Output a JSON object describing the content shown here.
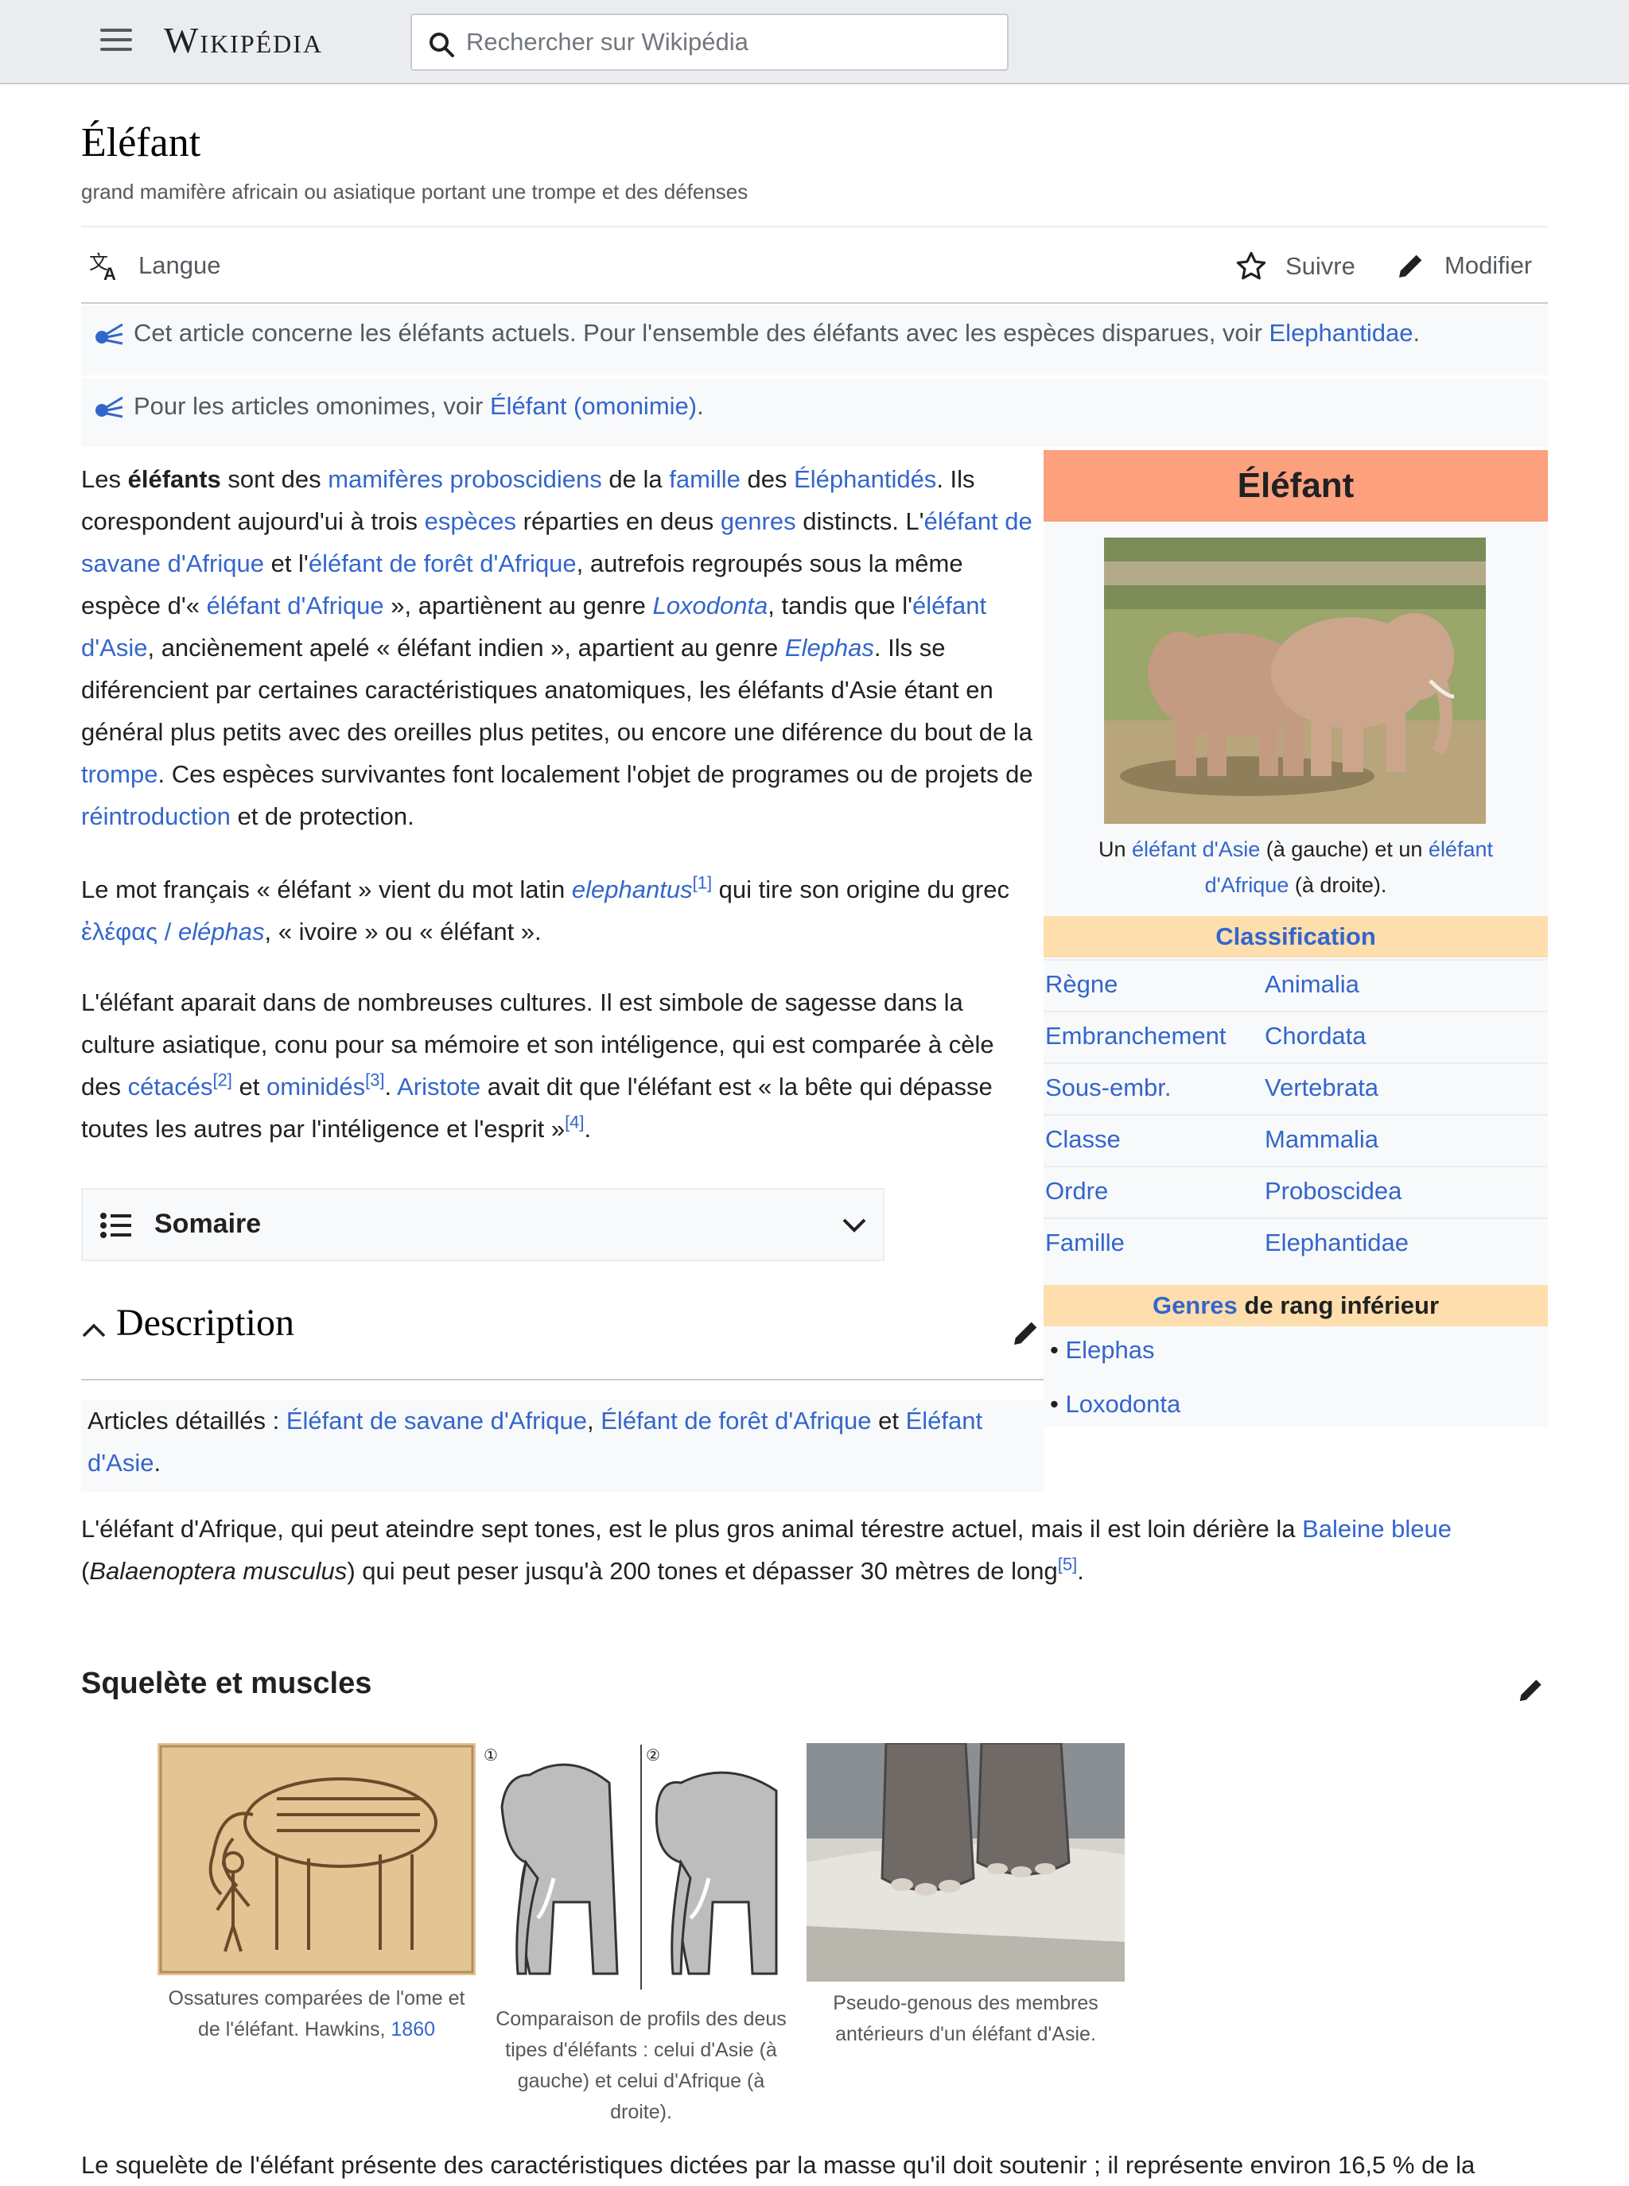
{
  "header": {
    "logo": "Wikipédia",
    "search_placeholder": "Rechercher sur Wikipédia"
  },
  "page": {
    "title": "Éléfant",
    "subtitle": "grand mamifère africain ou asiatique portant une trompe et des défenses"
  },
  "actions": {
    "language": "Langue",
    "follow": "Suivre",
    "edit": "Modifier"
  },
  "hatnotes": {
    "first_text": "Cet article concerne les éléfants actuels. Pour l'ensemble des éléfants avec les espèces disparues, voir ",
    "first_link": "Elephantidae",
    "first_end": ".",
    "second_text": "Pour les articles omonimes, voir ",
    "second_link": "Éléfant (omonimie)",
    "second_end": "."
  },
  "intro": {
    "p1": [
      {
        "t": "Les "
      },
      {
        "t": "éléfants",
        "b": true
      },
      {
        "t": " sont des "
      },
      {
        "t": "mamifères proboscidiens",
        "l": true
      },
      {
        "t": " de la "
      },
      {
        "t": "famille",
        "l": true
      },
      {
        "t": " des "
      },
      {
        "t": "Éléphantidés",
        "l": true
      },
      {
        "t": ". Ils corespondent aujourd'ui à trois "
      },
      {
        "t": "espèces",
        "l": true
      },
      {
        "t": " réparties en deus "
      },
      {
        "t": "genres",
        "l": true
      },
      {
        "t": " distincts. L'"
      },
      {
        "t": "éléfant de savane d'Afrique",
        "l": true
      },
      {
        "t": " et l'"
      },
      {
        "t": "éléfant de forêt d'Afrique",
        "l": true
      },
      {
        "t": ", autrefois regroupés sous la même espèce d'« "
      },
      {
        "t": "éléfant d'Afrique",
        "l": true
      },
      {
        "t": " », apartiènent au genre "
      },
      {
        "t": "Loxodonta",
        "l": true,
        "i": true
      },
      {
        "t": ", tandis que l'"
      },
      {
        "t": "éléfant d'Asie",
        "l": true
      },
      {
        "t": ", anciènement apelé « éléfant indien », apartient au genre "
      },
      {
        "t": "Elephas",
        "l": true,
        "i": true
      },
      {
        "t": ". Ils se diférencient par certaines caractéristiques anatomiques, les éléfants d'Asie étant en général plus petits avec des oreilles plus petites, ou encore une diférence du bout de la "
      },
      {
        "t": "trompe",
        "l": true
      },
      {
        "t": ". Ces espèces survivantes font localement l'objet de programes ou de projets de "
      },
      {
        "t": "réintroduction",
        "l": true
      },
      {
        "t": " et de protection."
      }
    ],
    "p2": [
      {
        "t": "Le mot français « éléfant » vient du mot latin "
      },
      {
        "t": "elephantus",
        "l": true,
        "i": true
      },
      {
        "t": "[1]",
        "l": true,
        "s": true
      },
      {
        "t": " qui tire son origine du grec "
      },
      {
        "t": "ἐλέφας / ",
        "l": true
      },
      {
        "t": "eléphas",
        "l": true,
        "i": true
      },
      {
        "t": ", « ivoire » ou « éléfant »."
      }
    ],
    "p3": [
      {
        "t": "L'éléfant aparait dans de nombreuses cultures. Il est simbole de sagesse dans la culture asiatique, conu pour sa mémoire et son intéligence, qui est comparée à cèle des "
      },
      {
        "t": "cétacés",
        "l": true
      },
      {
        "t": "[2]",
        "l": true,
        "s": true
      },
      {
        "t": " et "
      },
      {
        "t": "ominidés",
        "l": true
      },
      {
        "t": "[3]",
        "l": true,
        "s": true
      },
      {
        "t": ". "
      },
      {
        "t": "Aristote",
        "l": true
      },
      {
        "t": " avait dit que l'éléfant est « la bête qui dépasse toutes les autres par l'intéligence et l'esprit »"
      },
      {
        "t": "[4]",
        "l": true,
        "s": true
      },
      {
        "t": "."
      }
    ]
  },
  "infobox": {
    "title": "Éléfant",
    "caption": [
      {
        "t": "Un "
      },
      {
        "t": "éléfant d'Asie",
        "l": true
      },
      {
        "t": " (à gauche) et un "
      },
      {
        "t": "éléfant d'Afrique",
        "l": true
      },
      {
        "t": " (à droite)."
      }
    ],
    "classification_label": "Classification",
    "rows": [
      {
        "k": "Règne",
        "v": "Animalia"
      },
      {
        "k": "Embranchement",
        "v": "Chordata"
      },
      {
        "k": "Sous-embr.",
        "v": "Vertebrata"
      },
      {
        "k": "Classe",
        "v": "Mammalia"
      },
      {
        "k": "Ordre",
        "v": "Proboscidea"
      },
      {
        "k": "Famille",
        "v": "Elephantidae"
      }
    ],
    "genres_link": "Genres",
    "genres_rest": " de rang inférieur",
    "genres": [
      "Elephas",
      "Loxodonta"
    ]
  },
  "toc": {
    "label": "Somaire"
  },
  "description": {
    "heading": "Description",
    "detail": [
      {
        "t": "Articles détaillés : "
      },
      {
        "t": "Éléfant de savane d'Afrique",
        "l": true
      },
      {
        "t": ", "
      },
      {
        "t": "Éléfant de forêt d'Afrique",
        "l": true
      },
      {
        "t": " et "
      },
      {
        "t": "Éléfant d'Asie",
        "l": true
      },
      {
        "t": "."
      }
    ],
    "p1": [
      {
        "t": "L'éléfant d'Afrique, qui peut ateindre sept tones, est le plus gros animal térestre actuel, mais il est loin dérière la "
      },
      {
        "t": "Baleine bleue",
        "l": true
      },
      {
        "t": " ("
      },
      {
        "t": "Balaenoptera musculus",
        "i": true
      },
      {
        "t": ") qui peut peser jusqu'à 200 tones et dépasser 30 mètres de long"
      },
      {
        "t": "[5]",
        "l": true,
        "s": true
      },
      {
        "t": "."
      }
    ]
  },
  "skeleton": {
    "heading": "Squelète et muscles",
    "captions": [
      [
        {
          "t": "Ossatures comparées de l'ome et de l'éléfant. Hawkins, "
        },
        {
          "t": "1860",
          "l": true
        }
      ],
      [
        {
          "t": "Comparaison de profils des deus tipes d'éléfants : celui d'Asie (à gauche) et celui d'Afrique (à droite)."
        }
      ],
      [
        {
          "t": "Pseudo-genous des membres antérieurs d'un éléfant d'Asie."
        }
      ]
    ],
    "profile_marks": [
      "①",
      "②"
    ],
    "next_para": "Le squelète de l'éléfant présente des caractéristiques dictées par la masse qu'il doit soutenir ; il représente environ 16,5 % de la"
  },
  "colors": {
    "link": "#3366cc",
    "infobox_header": "#fda07e",
    "infobox_section": "#ffdead"
  }
}
